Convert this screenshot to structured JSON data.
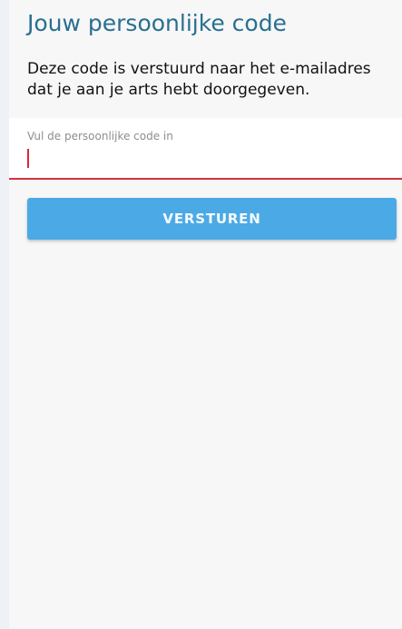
{
  "page": {
    "title": "Jouw persoonlijke code",
    "description": "Deze code is verstuurd naar het e-mailadres dat je aan je arts hebt doorgegeven."
  },
  "code_field": {
    "label": "Vul de persoonlijke code in",
    "value": ""
  },
  "actions": {
    "submit_label": "VERSTUREN"
  },
  "colors": {
    "title": "#286f91",
    "button": "#4baae6",
    "error_underline": "#d6323d"
  }
}
